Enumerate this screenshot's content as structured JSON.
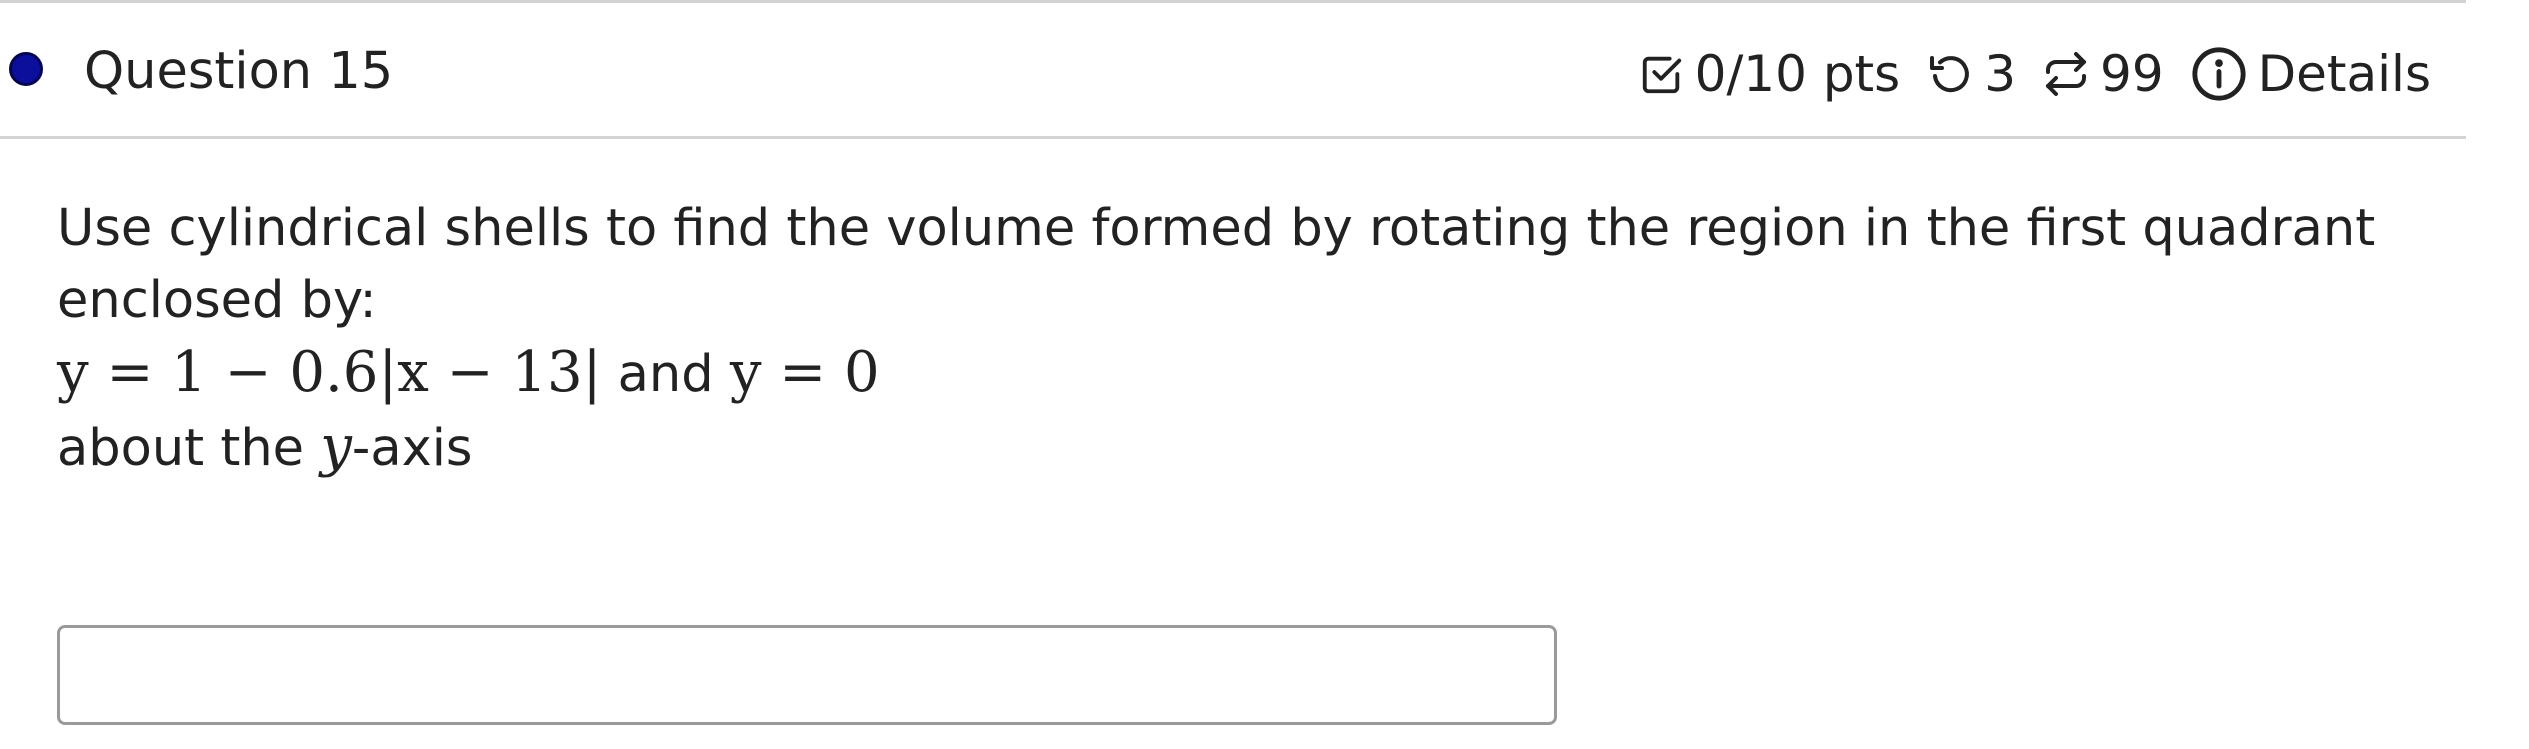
{
  "question": {
    "title": "Question 15",
    "status_color": "#0b0f9c"
  },
  "meta": {
    "score": "0/10 pts",
    "score_icon": "checkbox-icon",
    "attempts": "3",
    "attempts_icon": "undo-icon",
    "versions": "99",
    "versions_icon": "repeat-icon",
    "details_label": "Details",
    "details_icon": "info-icon"
  },
  "content": {
    "prompt": "Use cylindrical shells to find the volume formed by rotating the region in the first quadrant enclosed by:",
    "equation_1": "y = 1 − 0.6|x − 13|",
    "and_text": " and ",
    "equation_2": "y = 0",
    "about_prefix": "about the ",
    "about_var": "y",
    "about_suffix": "-axis"
  },
  "answer": {
    "value": "",
    "placeholder": ""
  }
}
